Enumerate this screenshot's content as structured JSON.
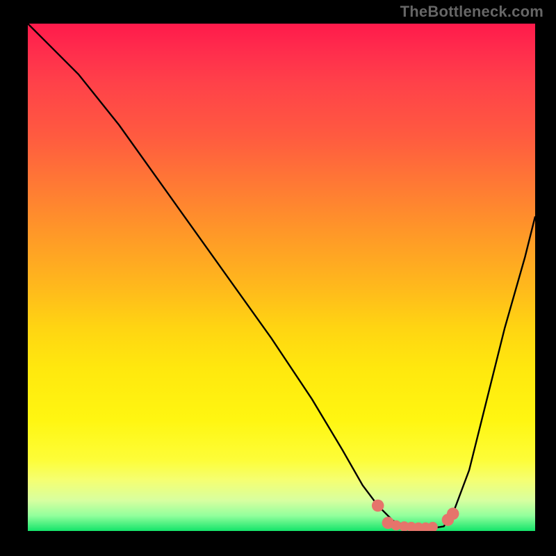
{
  "watermark": "TheBottleneck.com",
  "chart_data": {
    "type": "line",
    "title": "",
    "xlabel": "",
    "ylabel": "",
    "xlim": [
      0,
      100
    ],
    "ylim": [
      0,
      100
    ],
    "grid": false,
    "series": [
      {
        "name": "bottleneck-curve",
        "x": [
          0,
          4,
          10,
          18,
          28,
          38,
          48,
          56,
          62,
          66,
          69,
          72,
          75,
          78,
          80,
          82,
          84,
          87,
          90,
          94,
          98,
          100
        ],
        "values": [
          100,
          96,
          90,
          80,
          66,
          52,
          38,
          26,
          16,
          9,
          5,
          2,
          0.9,
          0.6,
          0.6,
          0.9,
          4,
          12,
          24,
          40,
          54,
          62
        ]
      }
    ],
    "markers": [
      {
        "name": "flat-left-end",
        "x": 69.0,
        "y": 5.0,
        "r": 1.2,
        "color": "#e6746b"
      },
      {
        "name": "flat-a",
        "x": 71.0,
        "y": 1.6,
        "r": 1.2,
        "color": "#e6746b"
      },
      {
        "name": "flat-b",
        "x": 72.6,
        "y": 1.1,
        "r": 1.0,
        "color": "#e6746b"
      },
      {
        "name": "flat-c",
        "x": 74.2,
        "y": 0.9,
        "r": 1.0,
        "color": "#e6746b"
      },
      {
        "name": "flat-d",
        "x": 75.6,
        "y": 0.8,
        "r": 1.0,
        "color": "#e6746b"
      },
      {
        "name": "flat-e",
        "x": 77.0,
        "y": 0.7,
        "r": 1.0,
        "color": "#e6746b"
      },
      {
        "name": "flat-f",
        "x": 78.4,
        "y": 0.7,
        "r": 1.0,
        "color": "#e6746b"
      },
      {
        "name": "flat-g",
        "x": 79.8,
        "y": 0.8,
        "r": 1.0,
        "color": "#e6746b"
      },
      {
        "name": "flat-right-a",
        "x": 82.8,
        "y": 2.2,
        "r": 1.2,
        "color": "#e6746b"
      },
      {
        "name": "flat-right-b",
        "x": 83.8,
        "y": 3.4,
        "r": 1.2,
        "color": "#e6746b"
      }
    ],
    "colors": {
      "curve": "#000000",
      "marker": "#e6746b"
    }
  }
}
